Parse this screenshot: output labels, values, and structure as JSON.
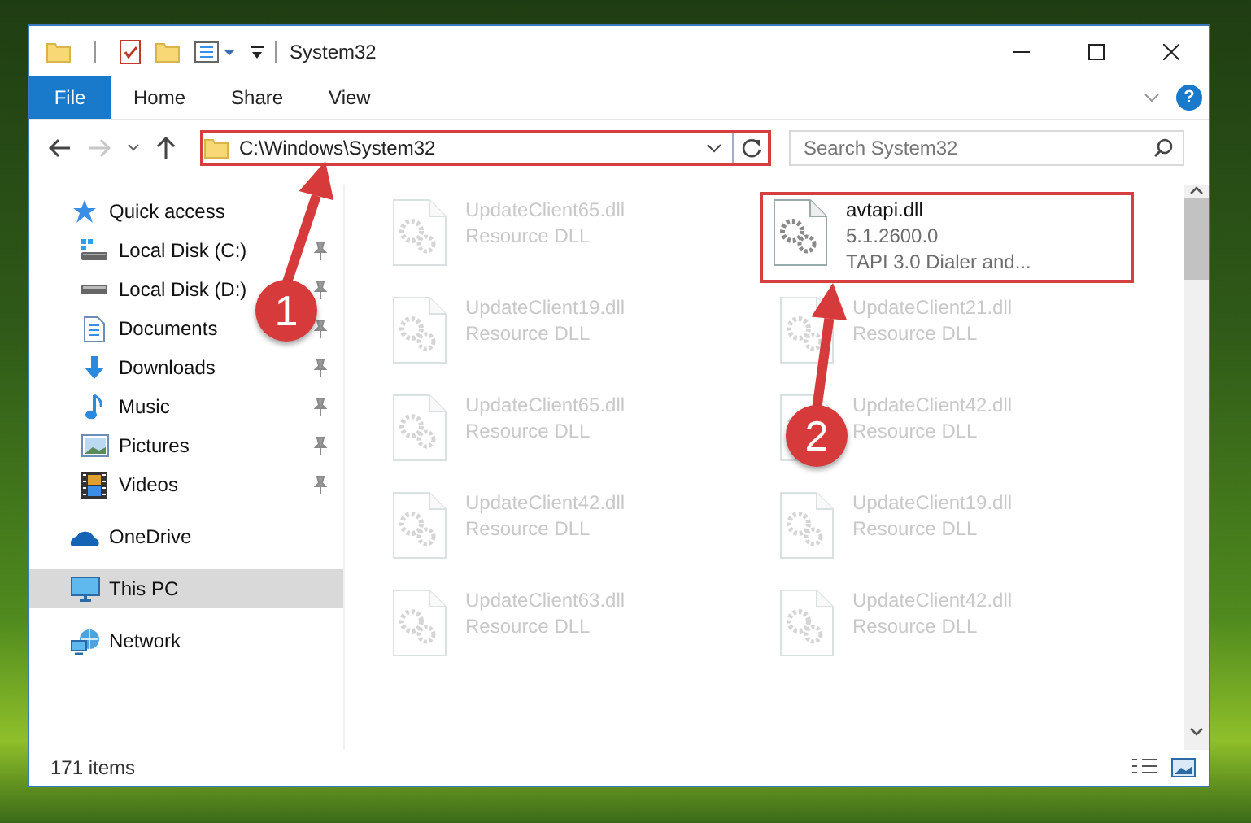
{
  "window": {
    "title": "System32"
  },
  "ribbon_tabs": [
    {
      "label": "File",
      "selected": true
    },
    {
      "label": "Home",
      "selected": false
    },
    {
      "label": "Share",
      "selected": false
    },
    {
      "label": "View",
      "selected": false
    }
  ],
  "help_button": {
    "label": "?"
  },
  "address_bar": {
    "path": "C:\\Windows\\System32",
    "annotated": true
  },
  "search": {
    "placeholder": "Search System32"
  },
  "sidebar": {
    "items": [
      {
        "label": "Quick access",
        "selected": false,
        "children": [
          {
            "label": "Local Disk (C:)",
            "selected": false,
            "pinned": true
          },
          {
            "label": "Local Disk (D:)",
            "selected": false,
            "pinned": true
          },
          {
            "label": "Documents",
            "selected": false,
            "pinned": true
          },
          {
            "label": "Downloads",
            "selected": false,
            "pinned": true
          },
          {
            "label": "Music",
            "selected": false,
            "pinned": true
          },
          {
            "label": "Pictures",
            "selected": false,
            "pinned": true
          },
          {
            "label": "Videos",
            "selected": false,
            "pinned": true
          }
        ]
      },
      {
        "label": "OneDrive",
        "selected": false
      },
      {
        "label": "This PC",
        "selected": true
      },
      {
        "label": "Network",
        "selected": false
      }
    ]
  },
  "files": [
    {
      "name": "UpdateClient65.dll",
      "details": [
        "Resource DLL"
      ],
      "blurred": true,
      "annotated": false
    },
    {
      "name": "avtapi.dll",
      "details": [
        "5.1.2600.0",
        "TAPI 3.0 Dialer and..."
      ],
      "blurred": false,
      "annotated": true
    },
    {
      "name": "UpdateClient19.dll",
      "details": [
        "Resource DLL"
      ],
      "blurred": true,
      "annotated": false
    },
    {
      "name": "UpdateClient21.dll",
      "details": [
        "Resource DLL"
      ],
      "blurred": true,
      "annotated": false
    },
    {
      "name": "UpdateClient65.dll",
      "details": [
        "Resource DLL"
      ],
      "blurred": true,
      "annotated": false
    },
    {
      "name": "UpdateClient42.dll",
      "details": [
        "Resource DLL"
      ],
      "blurred": true,
      "annotated": false
    },
    {
      "name": "UpdateClient42.dll",
      "details": [
        "Resource DLL"
      ],
      "blurred": true,
      "annotated": false
    },
    {
      "name": "UpdateClient19.dll",
      "details": [
        "Resource DLL"
      ],
      "blurred": true,
      "annotated": false
    },
    {
      "name": "UpdateClient63.dll",
      "details": [
        "Resource DLL"
      ],
      "blurred": true,
      "annotated": false
    },
    {
      "name": "UpdateClient42.dll",
      "details": [
        "Resource DLL"
      ],
      "blurred": true,
      "annotated": false
    }
  ],
  "callouts": [
    {
      "label": "1"
    },
    {
      "label": "2"
    }
  ],
  "status_bar": {
    "item_count": "171 items"
  }
}
